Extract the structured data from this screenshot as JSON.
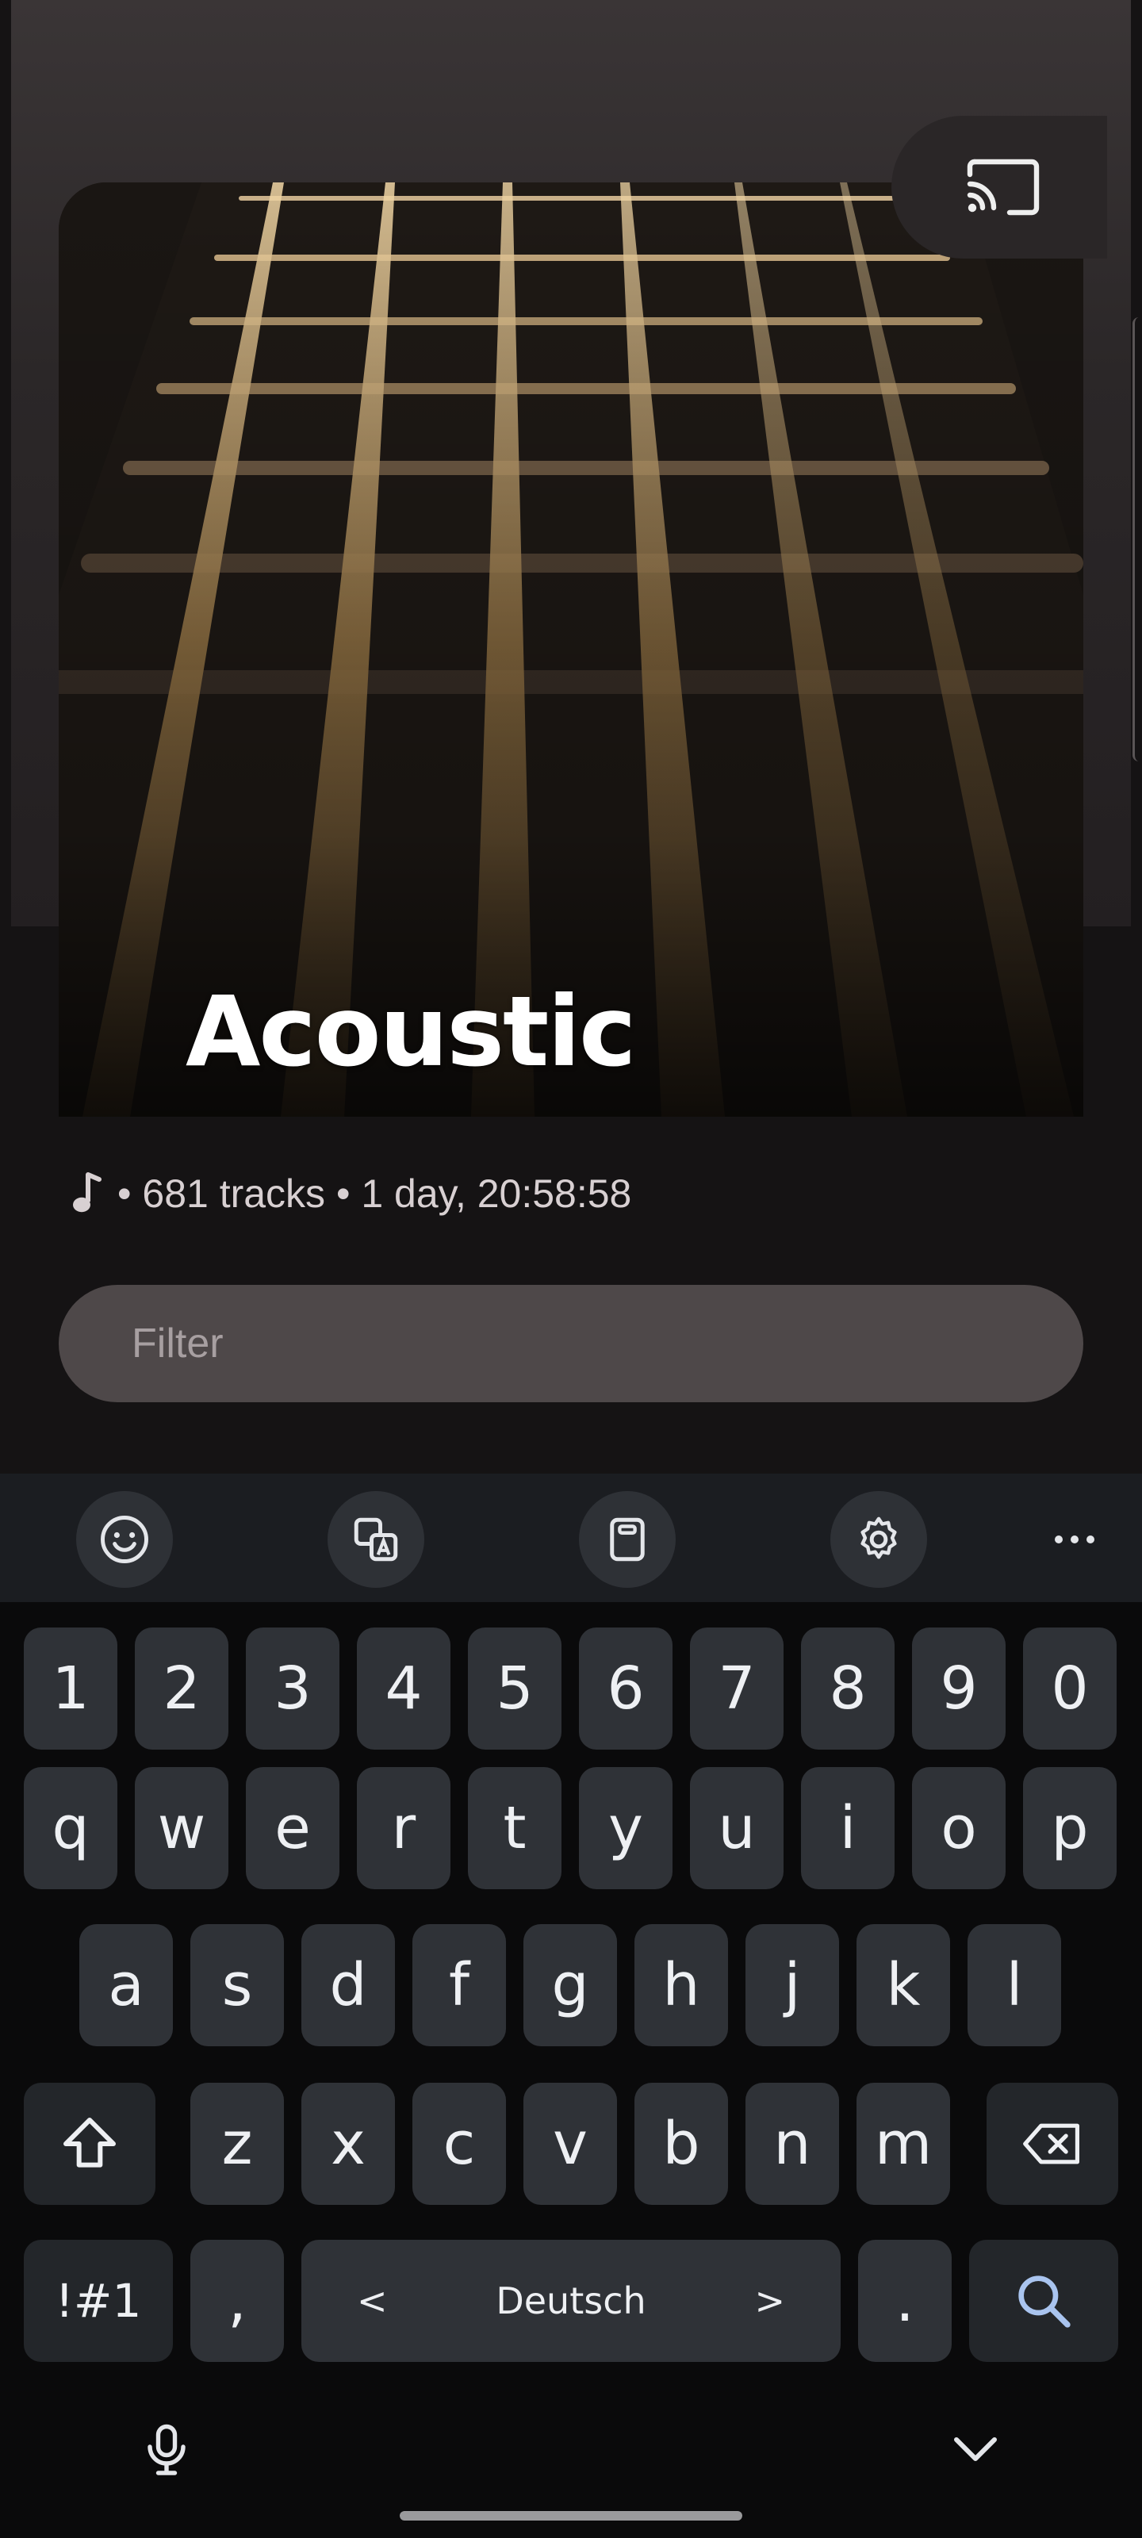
{
  "playlist": {
    "title": "Acoustic",
    "meta_icon": "music-note-icon",
    "meta_text": "• 681 tracks • 1 day, 20:58:58"
  },
  "cast": {
    "icon": "cast-icon"
  },
  "filter": {
    "placeholder": "Filter",
    "value": ""
  },
  "keyboard": {
    "toolbar": [
      "emoji-icon",
      "translate-icon",
      "clipboard-icon",
      "settings-icon",
      "more-icon"
    ],
    "number_row": [
      "1",
      "2",
      "3",
      "4",
      "5",
      "6",
      "7",
      "8",
      "9",
      "0"
    ],
    "row1": [
      "q",
      "w",
      "e",
      "r",
      "t",
      "y",
      "u",
      "i",
      "o",
      "p"
    ],
    "row2": [
      "a",
      "s",
      "d",
      "f",
      "g",
      "h",
      "j",
      "k",
      "l"
    ],
    "row3": [
      "z",
      "x",
      "c",
      "v",
      "b",
      "n",
      "m"
    ],
    "symbols_label": "!#1",
    "comma_label": ",",
    "space_label": "Deutsch",
    "space_left": "<",
    "space_right": ">",
    "period_label": "."
  },
  "colors": {
    "background": "#151314",
    "filter_bg": "#4e4849",
    "key_bg": "#2f3237",
    "keyboard_bg": "#0a0a0b"
  }
}
